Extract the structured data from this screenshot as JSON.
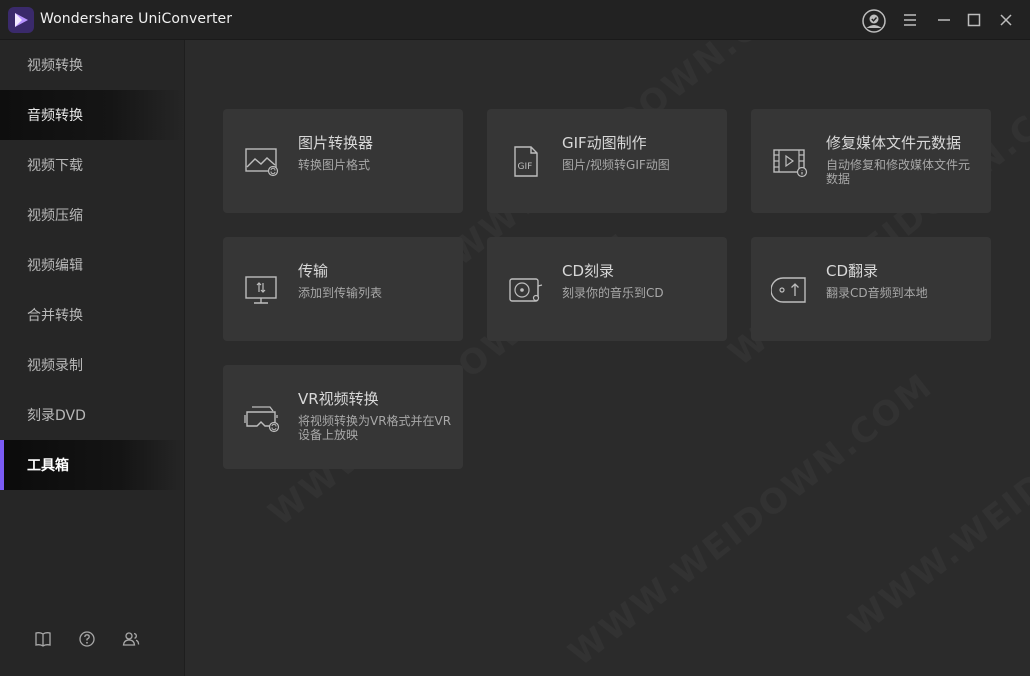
{
  "app": {
    "title": "Wondershare UniConverter"
  },
  "colors": {
    "accent": "#7b5cf5",
    "background": "#2b2b2b",
    "sidebar": "#262626",
    "card": "#363636"
  },
  "titlebar": {
    "icons": [
      "account-icon",
      "menu-icon",
      "minimize-icon",
      "maximize-icon",
      "close-icon"
    ]
  },
  "sidebar": {
    "items": [
      {
        "label": "视频转换"
      },
      {
        "label": "音频转换"
      },
      {
        "label": "视频下载"
      },
      {
        "label": "视频压缩"
      },
      {
        "label": "视频编辑"
      },
      {
        "label": "合并转换"
      },
      {
        "label": "视频录制"
      },
      {
        "label": "刻录DVD"
      },
      {
        "label": "工具箱"
      }
    ],
    "footer_icons": [
      "book-icon",
      "help-icon",
      "users-icon"
    ]
  },
  "toolbox": {
    "cards": [
      {
        "title": "图片转换器",
        "desc": "转换图片格式",
        "icon": "image-convert-icon"
      },
      {
        "title": "GIF动图制作",
        "desc": "图片/视频转GIF动图",
        "icon": "gif-icon"
      },
      {
        "title": "修复媒体文件元数据",
        "desc": "自动修复和修改媒体文件元数据",
        "icon": "metadata-icon"
      },
      {
        "title": "传输",
        "desc": "添加到传输列表",
        "icon": "transfer-icon"
      },
      {
        "title": "CD刻录",
        "desc": "刻录你的音乐到CD",
        "icon": "cd-burn-icon"
      },
      {
        "title": "CD翻录",
        "desc": "翻录CD音频到本地",
        "icon": "cd-rip-icon"
      },
      {
        "title": "VR视频转换",
        "desc": "将视频转换为VR格式并在VR设备上放映",
        "icon": "vr-icon"
      }
    ]
  },
  "watermark": "WWW.WEIDOWN.COM"
}
